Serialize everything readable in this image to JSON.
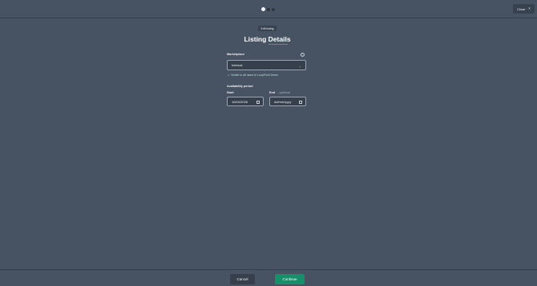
{
  "steps": {
    "total": 3,
    "current": 1
  },
  "top": {
    "close_label": "Close",
    "close_icon": "×"
  },
  "header": {
    "pill": "Edit listing",
    "title": "Listing Details"
  },
  "form": {
    "marketplace_label": "Marketplace",
    "info_icon": "i",
    "marketplace_value": "Internal",
    "hint_icon": "⌂",
    "hint_text": "Visible to all users in LoopPoint Demo",
    "period_label": "Availability period",
    "start_label": "Start",
    "start_value": "16/04/2026",
    "end_label": "End",
    "end_optional": "- optional",
    "end_placeholder": "dd/mm/yyyy"
  },
  "footer": {
    "cancel_label": "Cancel",
    "continue_label": "Continue"
  },
  "colors": {
    "background": "#475263",
    "accent": "#16906a"
  }
}
